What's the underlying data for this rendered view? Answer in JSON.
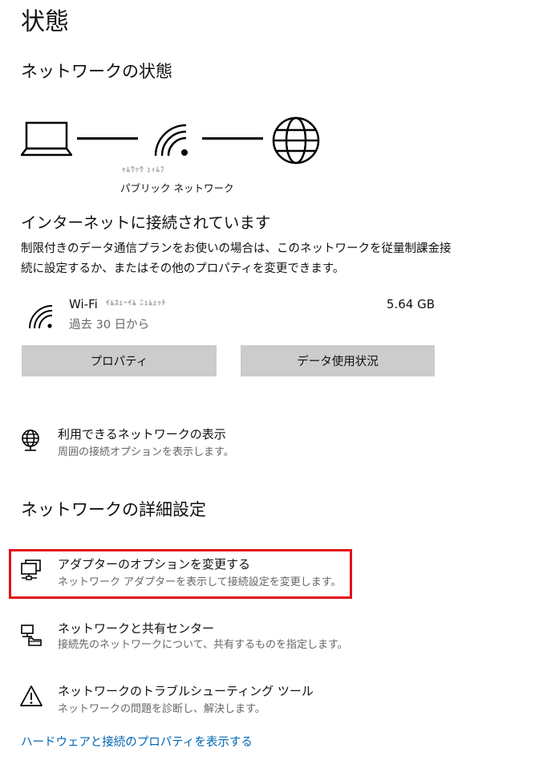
{
  "page": {
    "title": "状態"
  },
  "network_status": {
    "heading": "ネットワークの状態",
    "network_name_blurred": "ｬﾑﾜｯｳ ｪｨﾑﾌ",
    "network_type": "パブリック ネットワーク",
    "icons": [
      "laptop-icon",
      "wifi-icon",
      "globe-icon"
    ]
  },
  "connection": {
    "title": "インターネットに接続されています",
    "description": "制限付きのデータ通信プランをお使いの場合は、このネットワークを従量制課金接続に設定するか、またはその他のプロパティを変更できます。"
  },
  "wifi": {
    "name": "Wi-Fi",
    "ssid_blurred": "ｲﾑﾕｪｰｲﾑ ﾆｪﾑｪｯﾄ",
    "period": "過去 30 日から",
    "usage": "5.64 GB"
  },
  "buttons": {
    "properties": "プロパティ",
    "data_usage": "データ使用状況"
  },
  "available_networks": {
    "title": "利用できるネットワークの表示",
    "desc": "周囲の接続オプションを表示します。",
    "icon": "globe-network-icon"
  },
  "advanced": {
    "heading": "ネットワークの詳細設定",
    "items": [
      {
        "title": "アダプターのオプションを変更する",
        "desc": "ネットワーク アダプターを表示して接続設定を変更します。",
        "icon": "adapter-icon"
      },
      {
        "title": "ネットワークと共有センター",
        "desc": "接続先のネットワークについて、共有するものを指定します。",
        "icon": "sharing-center-icon"
      },
      {
        "title": "ネットワークのトラブルシューティング ツール",
        "desc": "ネットワークの問題を診断し、解決します。",
        "icon": "warning-icon"
      }
    ]
  },
  "footer": {
    "link": "ハードウェアと接続のプロパティを表示する"
  },
  "colors": {
    "accent_link": "#0066b4",
    "highlight": "#e3101b",
    "button_bg": "#cccccc"
  }
}
